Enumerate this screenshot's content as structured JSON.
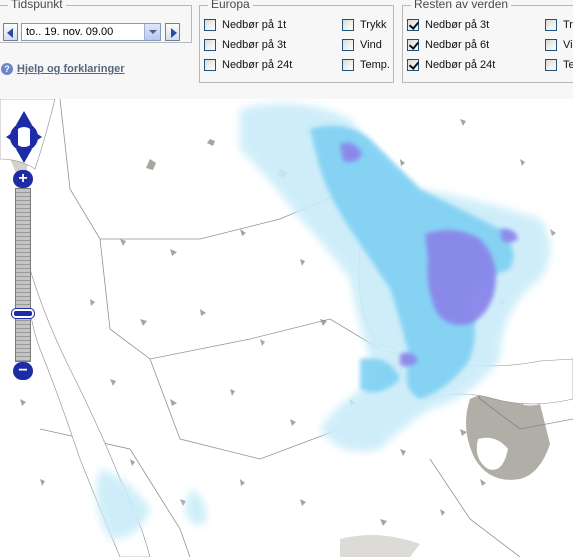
{
  "timepoint": {
    "legend": "Tidspunkt",
    "selected": "to.. 19. nov. 09.00",
    "prev_icon": "left-triangle-icon",
    "next_icon": "right-triangle-icon"
  },
  "help": {
    "label": "Hjelp og forklaringer",
    "icon": "question-icon"
  },
  "europa": {
    "legend": "Europa",
    "options": [
      {
        "label": "Nedbør på 1t",
        "checked": false
      },
      {
        "label": "Nedbør på 3t",
        "checked": false
      },
      {
        "label": "Nedbør på 24t",
        "checked": false
      },
      {
        "label": "Trykk",
        "checked": false
      },
      {
        "label": "Vind",
        "checked": false
      },
      {
        "label": "Temp.",
        "checked": false
      }
    ]
  },
  "rest": {
    "legend": "Resten av verden",
    "options": [
      {
        "label": "Nedbør på 3t",
        "checked": true
      },
      {
        "label": "Nedbør på 6t",
        "checked": true
      },
      {
        "label": "Nedbør på 24t",
        "checked": true
      },
      {
        "label": "Trykk",
        "checked": false
      },
      {
        "label": "Vind",
        "checked": false
      },
      {
        "label": "Temp.",
        "checked": false
      }
    ]
  },
  "map": {
    "zoom_in": "+",
    "zoom_out": "−",
    "zoom_level_fraction": 0.72,
    "colors": {
      "terrain": "#a7a59c",
      "rain_light": "#c9ecf9",
      "rain_mid": "#7fd0f3",
      "rain_heavy": "#8a86ea",
      "zoom_controls": "#1d2ba6"
    }
  }
}
